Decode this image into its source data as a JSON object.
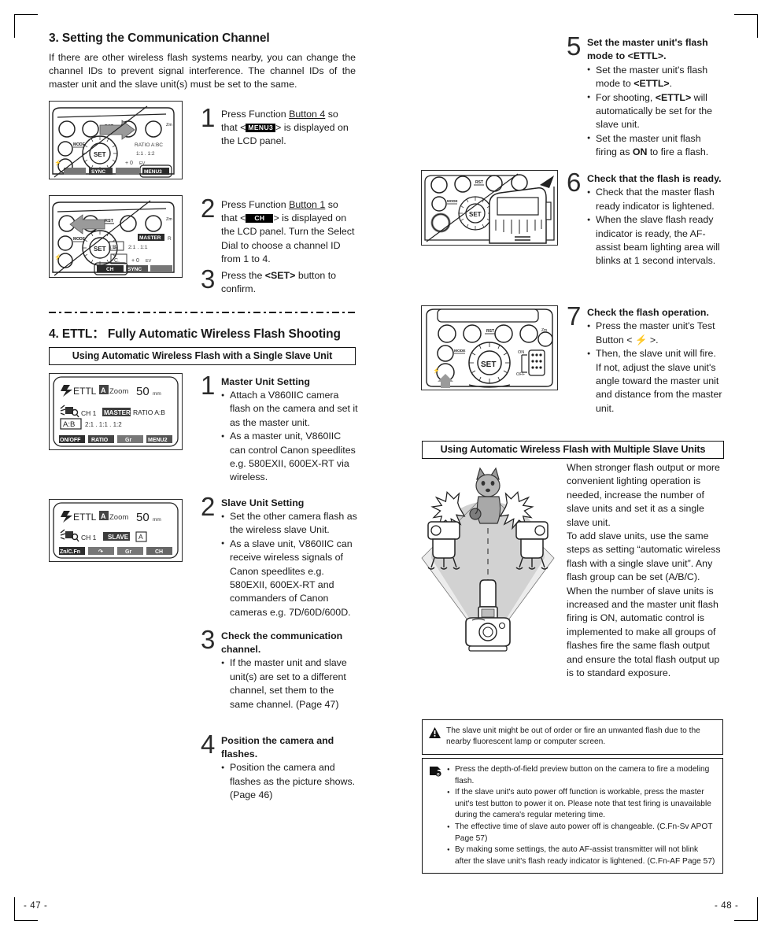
{
  "left": {
    "section3": {
      "title": "3. Setting the Communication Channel",
      "intro": "If there are other wireless flash systems nearby, you can change the channel IDs to prevent signal interference. The channel IDs of the master unit and the slave unit(s) must be set to the same.",
      "steps": [
        {
          "num": "1",
          "lines": [
            "Press Function Button 4 so",
            "that < MENU3 > is displayed",
            "on the LCD panel."
          ],
          "pre": "Press Function ",
          "underline": "Button 4",
          "mid": " so that <",
          "token": "MENU3",
          "post": "> is displayed on the LCD panel."
        },
        {
          "num": "2",
          "pre": "Press Function ",
          "underline": "Button 1",
          "mid": " so that <",
          "token": "CH",
          "post": "> is displayed on the LCD panel. Turn the Select Dial to choose a channel ID from 1 to 4."
        },
        {
          "num": "3",
          "text_a": "Press the ",
          "text_b": "<SET>",
          "text_c": " button to confirm."
        }
      ],
      "fig1": {
        "lcd_tokens": [
          "SYNC",
          "MENU3"
        ],
        "lcd_text": [
          "RATIO A:BC",
          "1:1 . 1:2",
          "+ 0 EV"
        ],
        "dial_label": "SET",
        "mode_label": "MODE",
        "rst_label": "RST"
      },
      "fig2": {
        "lcd_tokens": [
          "CH",
          "SYNC"
        ],
        "lcd_text": [
          "MASTER  R",
          "2:1 . 1:1",
          "C. + 0 EV",
          "A:B"
        ],
        "dial_label": "SET"
      }
    },
    "section4": {
      "title": "4. ETTL： Fully Automatic Wireless Flash Shooting",
      "subhead": "Using Automatic Wireless Flash with a Single Slave Unit",
      "lcd_master": {
        "mode": "ETTL",
        "zoom_label": "Zoom",
        "zoom_value": "50",
        "zoom_unit": "mm",
        "group_badge": "A",
        "channel": "CH 1",
        "role": "MASTER",
        "ratio_label": "RATIO A:B",
        "ratio_box": "A:B",
        "ratio_values": "2:1  .  1:1  .  1:2",
        "soft_keys": [
          "ON/OFF",
          "RATIO",
          "Gr",
          "MENU2"
        ]
      },
      "lcd_slave": {
        "mode": "ETTL",
        "zoom_label": "Zoom",
        "zoom_value": "50",
        "zoom_unit": "mm",
        "group_badge": "A",
        "channel": "CH 1",
        "role": "SLAVE",
        "group_box": "A",
        "soft_keys": [
          "Zn/C.Fn",
          "↯",
          "Gr",
          "CH"
        ]
      },
      "steps": [
        {
          "num": "1",
          "heading": "Master Unit Setting",
          "bullets": [
            "Attach a V860IIC camera flash on the camera and set it as the master unit.",
            "As a master unit, V860IIC can control Canon speedlites e.g. 580EXII, 600EX-RT via wireless."
          ]
        },
        {
          "num": "2",
          "heading": "Slave Unit Setting",
          "bullets": [
            "Set the other camera flash as the wireless slave Unit.",
            "As a slave unit, V860IIC can receive wireless signals of Canon speedlites e.g. 580EXII, 600EX-RT and commanders of Canon cameras e.g. 7D/60D/600D."
          ]
        },
        {
          "num": "3",
          "heading": "Check the communication channel.",
          "bullets": [
            "If the master unit and slave unit(s) are set to a different channel, set them to the same channel. (Page 47)"
          ]
        },
        {
          "num": "4",
          "heading": "Position the camera and flashes.",
          "bullets": [
            "Position the camera and flashes as the picture shows. (Page 46)"
          ]
        }
      ]
    },
    "page_number": "- 47 -"
  },
  "right": {
    "steps": [
      {
        "num": "5",
        "heading_a": "Set the master unit's flash mode to ",
        "heading_b": "<ETTL>",
        "heading_c": ".",
        "bullets": [
          {
            "a": "Set the master unit's flash mode to ",
            "b": "<ETTL>",
            "c": "."
          },
          {
            "a": "For shooting, ",
            "b": "<ETTL>",
            "c": " will automatically be set for the slave unit."
          },
          {
            "a": "Set the master unit flash firing as ",
            "b": "ON",
            "c": " to fire a flash."
          }
        ]
      },
      {
        "num": "6",
        "heading": "Check that the flash is ready.",
        "bullets": [
          "Check that the master flash ready indicator is lightened.",
          "When the slave flash ready indicator is ready, the AF-assist beam lighting area will blinks at 1 second intervals."
        ]
      },
      {
        "num": "7",
        "heading": "Check the flash operation.",
        "bullets_special": {
          "first_a": "Press the master unit's Test Button < ",
          "first_b": "⚡",
          "first_c": " >."
        },
        "bullets": [
          "Then, the slave unit will fire. If not, adjust the slave unit's angle toward the master unit and distance from the master unit."
        ]
      }
    ],
    "subhead": "Using Automatic Wireless Flash with Multiple Slave Units",
    "multi_paragraphs": [
      "When stronger flash output or more convenient lighting operation is needed, increase the number of slave units and set it as a single slave unit.",
      "To add slave units, use the same steps as setting “automatic wireless flash with a single slave unit”. Any flash group can be set (A/B/C).",
      "When the number of slave units is increased and the master unit flash firing is ON, automatic control is implemented to make all groups of flashes fire the same flash output and ensure the total flash output up is to standard exposure."
    ],
    "warning_note": {
      "icon": "warning-triangle-icon",
      "text": "The slave unit might be out of order or fire an unwanted flash due to the nearby fluorescent lamp or computer screen."
    },
    "info_note": {
      "icon": "info-note-icon",
      "bullets": [
        "Press the depth-of-field preview button on the camera to fire a modeling flash.",
        "If the slave unit's auto power off function is workable, press the master unit's test button to power it on. Please note that test firing is unavailable during the camera's regular metering time.",
        "The effective time of slave auto power off is changeable. (C.Fn-Sv APOT Page 57)",
        "By making some settings, the auto AF-assist transmitter will not blink after the slave unit's flash ready indicator is lightened. (C.Fn-AF Page 57)"
      ]
    },
    "page_number": "- 48 -"
  },
  "colors": {
    "ink": "#1a1a1a",
    "lcd_black": "#000000",
    "fill_light": "#d9d9d9",
    "fill_mid": "#9a9a9a",
    "fill_dark": "#6e6e6e"
  }
}
